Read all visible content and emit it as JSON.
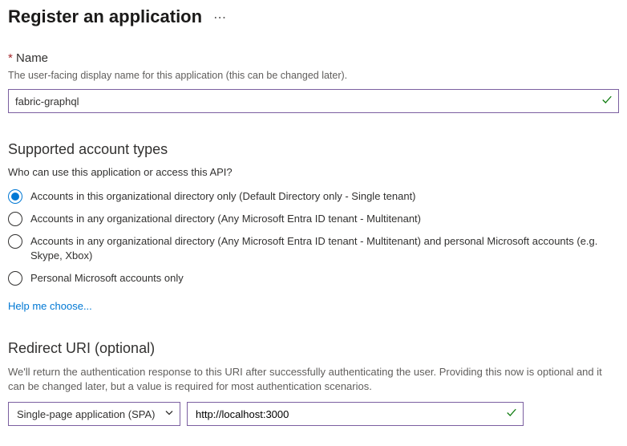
{
  "header": {
    "title": "Register an application"
  },
  "name": {
    "label": "Name",
    "desc": "The user-facing display name for this application (this can be changed later).",
    "value": "fabric-graphql"
  },
  "accountTypes": {
    "heading": "Supported account types",
    "question": "Who can use this application or access this API?",
    "options": [
      {
        "label": "Accounts in this organizational directory only (Default Directory only - Single tenant)",
        "selected": true
      },
      {
        "label": "Accounts in any organizational directory (Any Microsoft Entra ID tenant - Multitenant)",
        "selected": false
      },
      {
        "label": "Accounts in any organizational directory (Any Microsoft Entra ID tenant - Multitenant) and personal Microsoft accounts (e.g. Skype, Xbox)",
        "selected": false
      },
      {
        "label": "Personal Microsoft accounts only",
        "selected": false
      }
    ],
    "helpLink": "Help me choose..."
  },
  "redirect": {
    "heading": "Redirect URI (optional)",
    "desc": "We'll return the authentication response to this URI after successfully authenticating the user. Providing this now is optional and it can be changed later, but a value is required for most authentication scenarios.",
    "platform": "Single-page application (SPA)",
    "uri": "http://localhost:3000"
  }
}
